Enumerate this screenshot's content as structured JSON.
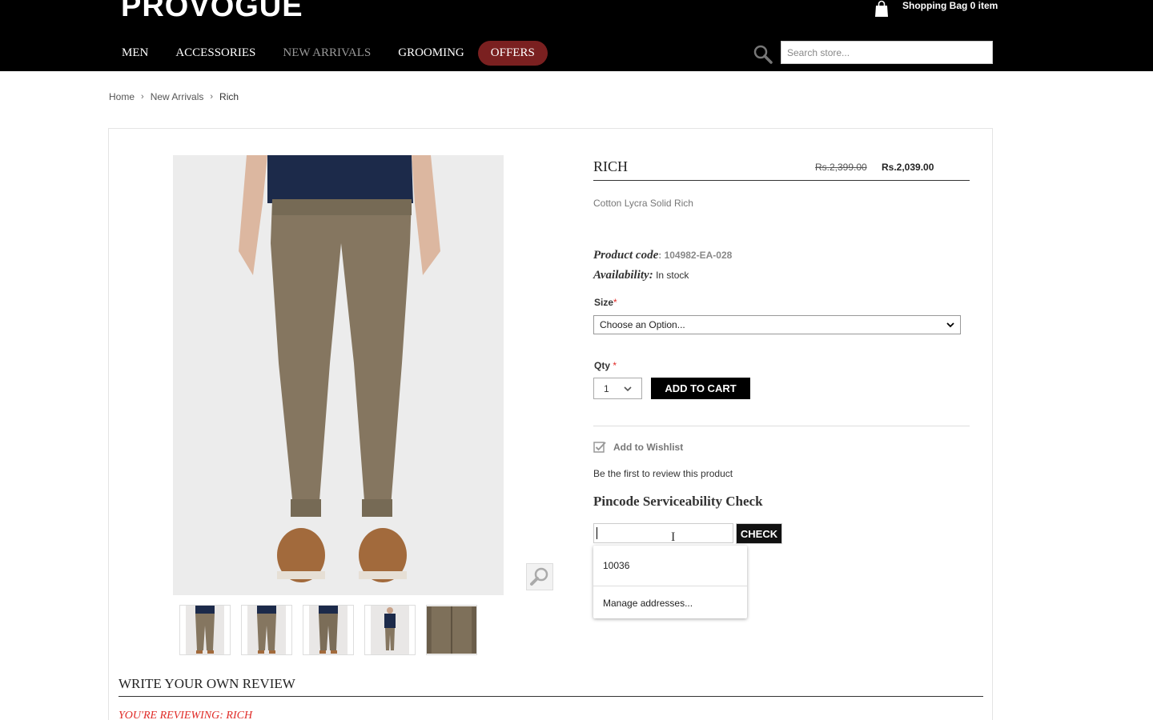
{
  "header": {
    "logo": "PROVOGUE",
    "bag_label": "Shopping Bag 0 item",
    "nav": [
      "MEN",
      "ACCESSORIES",
      "NEW ARRIVALS",
      "GROOMING",
      "OFFERS"
    ],
    "search_placeholder": "Search store..."
  },
  "breadcrumb": {
    "home": "Home",
    "section": "New Arrivals",
    "current": "Rich"
  },
  "product": {
    "name": "RICH",
    "old_price": "Rs.2,399.00",
    "price": "Rs.2,039.00",
    "description": "Cotton Lycra Solid Rich",
    "code_label": "Product code",
    "code": ": 104982-EA-028",
    "availability_label": "Availability:",
    "availability": "In stock",
    "size_label": "Size",
    "size_required": "*",
    "size_selected": "Choose an Option...",
    "qty_label": "Qty",
    "qty_required": "*",
    "qty_selected": "1",
    "add_to_cart": "ADD TO CART",
    "wishlist": "Add to Wishlist",
    "review_link": "Be the first to review this product",
    "thumbnail_count": 5
  },
  "pincode": {
    "title": "Pincode Serviceability Check",
    "input_value": "",
    "check_label": "CHECK",
    "suggestions": [
      "10036",
      "Manage addresses..."
    ]
  },
  "review": {
    "title": "WRITE YOUR OWN REVIEW",
    "reviewing": "YOU'RE REVIEWING: RICH"
  },
  "colors": {
    "header_bg": "#000000",
    "offers_bg": "#7a2020",
    "required": "#e02b27",
    "button_bg": "#000000"
  },
  "icons": [
    "shopping-bag-icon",
    "search-icon",
    "zoom-icon",
    "checkbox-icon",
    "chevron-down-icon",
    "text-cursor-icon"
  ]
}
